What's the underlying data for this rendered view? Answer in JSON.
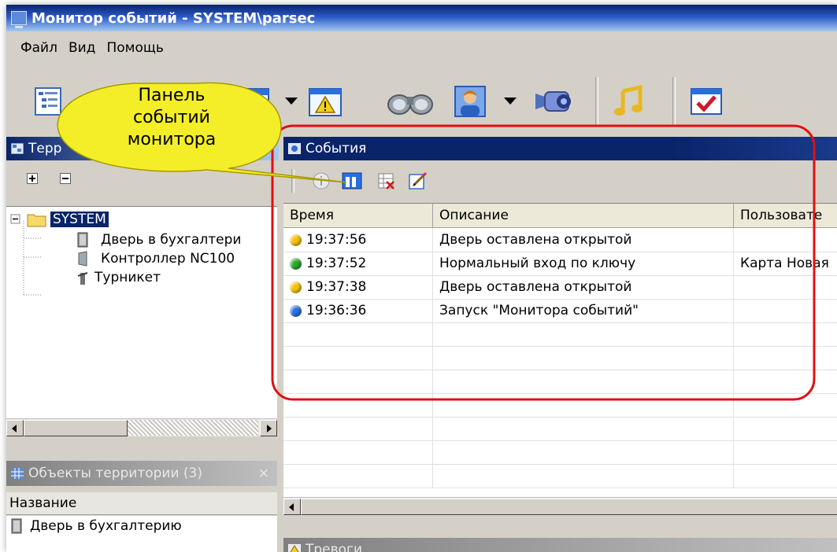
{
  "window": {
    "title": "Монитор событий - SYSTEM\\parsec"
  },
  "menu": [
    "Файл",
    "Вид",
    "Помощь"
  ],
  "toolbar": {
    "icons": [
      "tree-view-icon",
      "window-icon",
      "warning-icon",
      "binoculars-icon",
      "person-icon",
      "camera-icon",
      "music-note-icon",
      "checkmark-icon"
    ]
  },
  "territory_panel": {
    "title": "Терр",
    "tree": {
      "root": "SYSTEM",
      "children": [
        "Дверь в бухгалтери",
        "Контроллер NC100",
        "Турникет"
      ]
    }
  },
  "objects_panel": {
    "title": "Объекты территории (3)",
    "column": "Название",
    "items": [
      "Дверь в бухгалтерию"
    ]
  },
  "events_panel": {
    "title": "События",
    "columns": [
      "Время",
      "Описание",
      "Пользовате"
    ],
    "rows": [
      {
        "time": "19:37:56",
        "description": "Дверь оставлена открытой",
        "user": "",
        "status_color": "#f2c200"
      },
      {
        "time": "19:37:52",
        "description": "Нормальный вход по ключу",
        "user": "Карта Новая",
        "status_color": "#29a829"
      },
      {
        "time": "19:37:38",
        "description": "Дверь оставлена открытой",
        "user": "",
        "status_color": "#f2c200"
      },
      {
        "time": "19:36:36",
        "description": "Запуск \"Монитора событий\"",
        "user": "",
        "status_color": "#2a6fe0"
      }
    ]
  },
  "alarms_panel": {
    "title": "Тревоги"
  },
  "callout": {
    "lines": [
      "Панель",
      "событий",
      "монитора"
    ]
  },
  "colors": {
    "title_bar": "#0a246a",
    "highlight_outline": "#e01010",
    "callout_fill": "#f4ee28"
  }
}
